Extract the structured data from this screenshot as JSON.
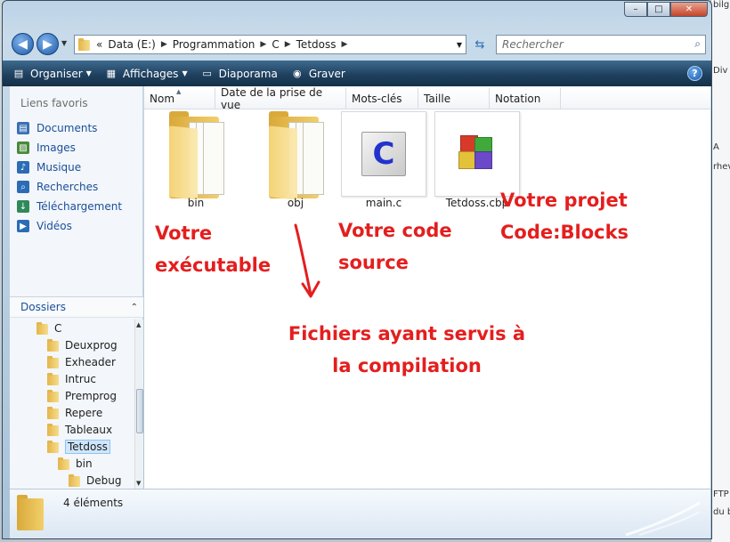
{
  "background_strip": {
    "lines": [
      "bilg",
      "",
      "",
      "",
      "",
      "",
      "A",
      "rhev",
      "",
      "",
      "",
      "",
      "",
      "",
      "",
      "FTP",
      "du b"
    ],
    "right_label": "Div"
  },
  "window": {
    "controls": {
      "minimize": "–",
      "maximize": "□",
      "close": "✕"
    }
  },
  "address_bar": {
    "prefix": "«",
    "crumbs": [
      "Data (E:)",
      "Programmation",
      "C",
      "Tetdoss"
    ],
    "search_placeholder": "Rechercher"
  },
  "toolbar": {
    "items": [
      {
        "label": "Organiser",
        "icon": "organize-icon",
        "has_arrow": true
      },
      {
        "label": "Affichages",
        "icon": "views-icon",
        "has_arrow": true
      },
      {
        "label": "Diaporama",
        "icon": "slideshow-icon",
        "has_arrow": false
      },
      {
        "label": "Graver",
        "icon": "burn-disc-icon",
        "has_arrow": false
      }
    ],
    "help": "?"
  },
  "favorites": {
    "title": "Liens favoris",
    "items": [
      {
        "label": "Documents",
        "icon": "documents-icon",
        "color": "#3a6fb5"
      },
      {
        "label": "Images",
        "icon": "images-icon",
        "color": "#4a8a3a"
      },
      {
        "label": "Musique",
        "icon": "music-icon",
        "color": "#2b6cb5"
      },
      {
        "label": "Recherches",
        "icon": "search-folder-icon",
        "color": "#2b6cb5"
      },
      {
        "label": "Téléchargement",
        "icon": "download-icon",
        "color": "#2f8a5a"
      },
      {
        "label": "Vidéos",
        "icon": "videos-icon",
        "color": "#2b6cb5"
      }
    ]
  },
  "folders": {
    "title": "Dossiers",
    "tree": [
      {
        "label": "C",
        "level": 0,
        "selected": false
      },
      {
        "label": "Deuxprog",
        "level": 1,
        "selected": false
      },
      {
        "label": "Exheader",
        "level": 1,
        "selected": false
      },
      {
        "label": "Intruc",
        "level": 1,
        "selected": false
      },
      {
        "label": "Premprog",
        "level": 1,
        "selected": false
      },
      {
        "label": "Repere",
        "level": 1,
        "selected": false
      },
      {
        "label": "Tableaux",
        "level": 1,
        "selected": false
      },
      {
        "label": "Tetdoss",
        "level": 1,
        "selected": true
      },
      {
        "label": "bin",
        "level": 2,
        "selected": false
      },
      {
        "label": "Debug",
        "level": 3,
        "selected": false
      }
    ]
  },
  "columns": [
    "Nom",
    "Date de la prise de vue",
    "Mots-clés",
    "Taille",
    "Notation"
  ],
  "files": [
    {
      "name": "bin",
      "type": "folder"
    },
    {
      "name": "obj",
      "type": "folder"
    },
    {
      "name": "main.c",
      "type": "c-source"
    },
    {
      "name": "Tetdoss.cbp",
      "type": "codeblocks-project"
    }
  ],
  "annotations": {
    "executable": [
      "Votre",
      "exécutable"
    ],
    "source": [
      "Votre code",
      "source"
    ],
    "project": [
      "Votre projet",
      "Code:Blocks"
    ],
    "compilation": [
      "Fichiers ayant servis à",
      "la compilation"
    ]
  },
  "colors": {
    "annotation_red": "#e41e1e",
    "link_blue": "#1a4f9a",
    "toolbar_dark": "#1f4160",
    "folder_gold": "#e3b64a"
  },
  "status": {
    "count": "4 éléments"
  }
}
